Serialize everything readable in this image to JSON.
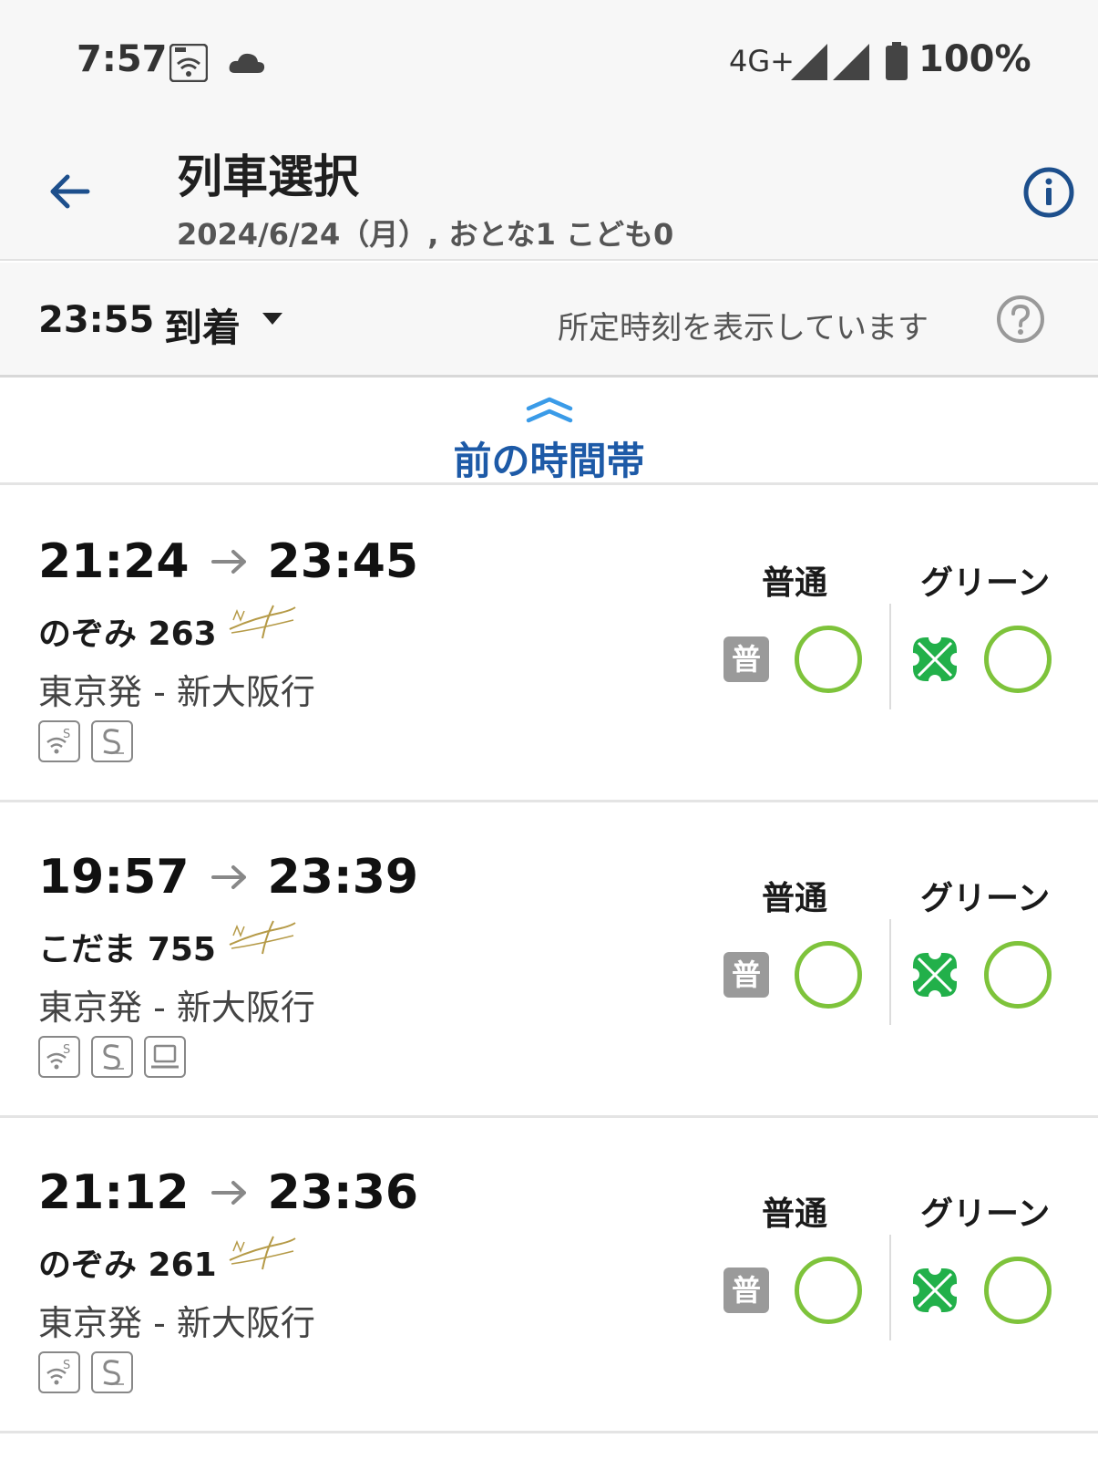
{
  "status_bar": {
    "time": "7:57",
    "network": "4G+",
    "battery": "100%",
    "icons": [
      "au-wifi-icon",
      "cloud-icon",
      "signal-icon",
      "signal-icon",
      "battery-icon"
    ]
  },
  "header": {
    "title": "列車選択",
    "subtitle": "2024/6/24（月）, おとな1 こども0",
    "accent_color": "#1d4f8c"
  },
  "filter": {
    "time": "23:55",
    "mode": "到着",
    "note": "所定時刻を表示しています"
  },
  "prev_band": {
    "label": "前の時間帯",
    "color": "#1d5aa7"
  },
  "seat_labels": {
    "standard": "普通",
    "green": "グリーン",
    "standard_badge": "普"
  },
  "trains": [
    {
      "departure": "21:24",
      "arrival": "23:45",
      "name": "のぞみ 263",
      "route": "東京発 - 新大阪行",
      "features": [
        "wifi-s-icon",
        "s-work-icon"
      ],
      "standard_available": "○",
      "green_available": "○"
    },
    {
      "departure": "19:57",
      "arrival": "23:39",
      "name": "こだま 755",
      "route": "東京発 - 新大阪行",
      "features": [
        "wifi-s-icon",
        "s-work-icon",
        "laptop-icon"
      ],
      "standard_available": "○",
      "green_available": "○"
    },
    {
      "departure": "21:12",
      "arrival": "23:36",
      "name": "のぞみ 261",
      "route": "東京発 - 新大阪行",
      "features": [
        "wifi-s-icon",
        "s-work-icon"
      ],
      "standard_available": "○",
      "green_available": "○"
    }
  ],
  "colors": {
    "available_circle": "#7ec33b",
    "green_car": "#22b04a",
    "badge_gray": "#9a9a9a"
  }
}
